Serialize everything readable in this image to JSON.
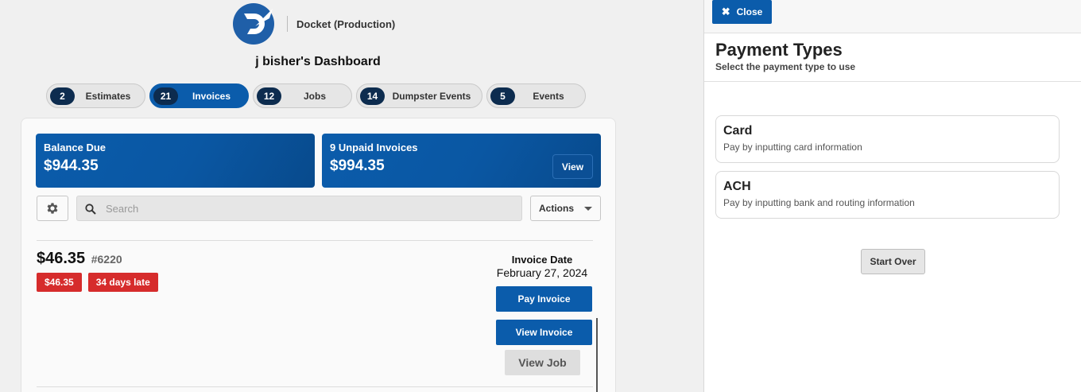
{
  "app": {
    "name": "Docket (Production)",
    "logo_icon": "docket-logo-icon"
  },
  "dashboard": {
    "title": "j bisher's Dashboard"
  },
  "tabs": [
    {
      "count": "2",
      "label": "Estimates",
      "active": false
    },
    {
      "count": "21",
      "label": "Invoices",
      "active": true
    },
    {
      "count": "12",
      "label": "Jobs",
      "active": false
    },
    {
      "count": "14",
      "label": "Dumpster Events",
      "active": false
    },
    {
      "count": "5",
      "label": "Events",
      "active": false
    }
  ],
  "summary": {
    "balance_label": "Balance Due",
    "balance_value": "$944.35",
    "unpaid_label": "9 Unpaid Invoices",
    "unpaid_value": "$994.35",
    "view_label": "View"
  },
  "toolbar": {
    "settings_icon": "gear-icon",
    "search_icon": "search-icon",
    "search_placeholder": "Search",
    "search_value": "",
    "actions_label": "Actions"
  },
  "invoice": {
    "amount": "$46.35",
    "number": "#6220",
    "badge_amount": "$46.35",
    "badge_late": "34 days late",
    "date_label": "Invoice Date",
    "date_value": "February 27, 2024",
    "pay_label": "Pay Invoice",
    "view_label": "View Invoice",
    "job_label": "View Job"
  },
  "panel": {
    "close_label": "Close",
    "title": "Payment Types",
    "subtitle": "Select the payment type to use",
    "options": [
      {
        "title": "Card",
        "desc": "Pay by inputting card information"
      },
      {
        "title": "ACH",
        "desc": "Pay by inputting bank and routing information"
      }
    ],
    "start_over_label": "Start Over"
  },
  "colors": {
    "primary": "#0b5cab",
    "danger": "#d62c2c",
    "count_badge": "#0d2c4f"
  }
}
